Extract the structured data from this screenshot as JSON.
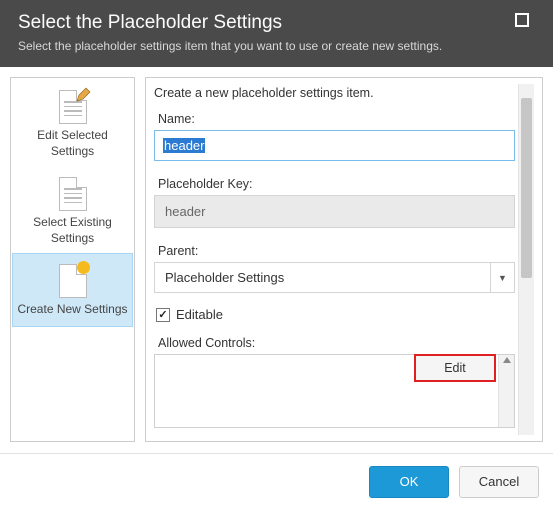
{
  "header": {
    "title": "Select the Placeholder Settings",
    "subtitle": "Select the placeholder settings item that you want to use or create new settings."
  },
  "sidebar": {
    "items": [
      {
        "label": "Edit Selected Settings"
      },
      {
        "label": "Select Existing Settings"
      },
      {
        "label": "Create New Settings"
      }
    ]
  },
  "form": {
    "heading": "Create a new placeholder settings item.",
    "name_label": "Name:",
    "name_value": "header",
    "key_label": "Placeholder Key:",
    "key_value": "header",
    "parent_label": "Parent:",
    "parent_value": "Placeholder Settings",
    "editable_label": "Editable",
    "editable_checked": true,
    "allowed_label": "Allowed Controls:",
    "edit_button": "Edit"
  },
  "footer": {
    "ok": "OK",
    "cancel": "Cancel"
  }
}
